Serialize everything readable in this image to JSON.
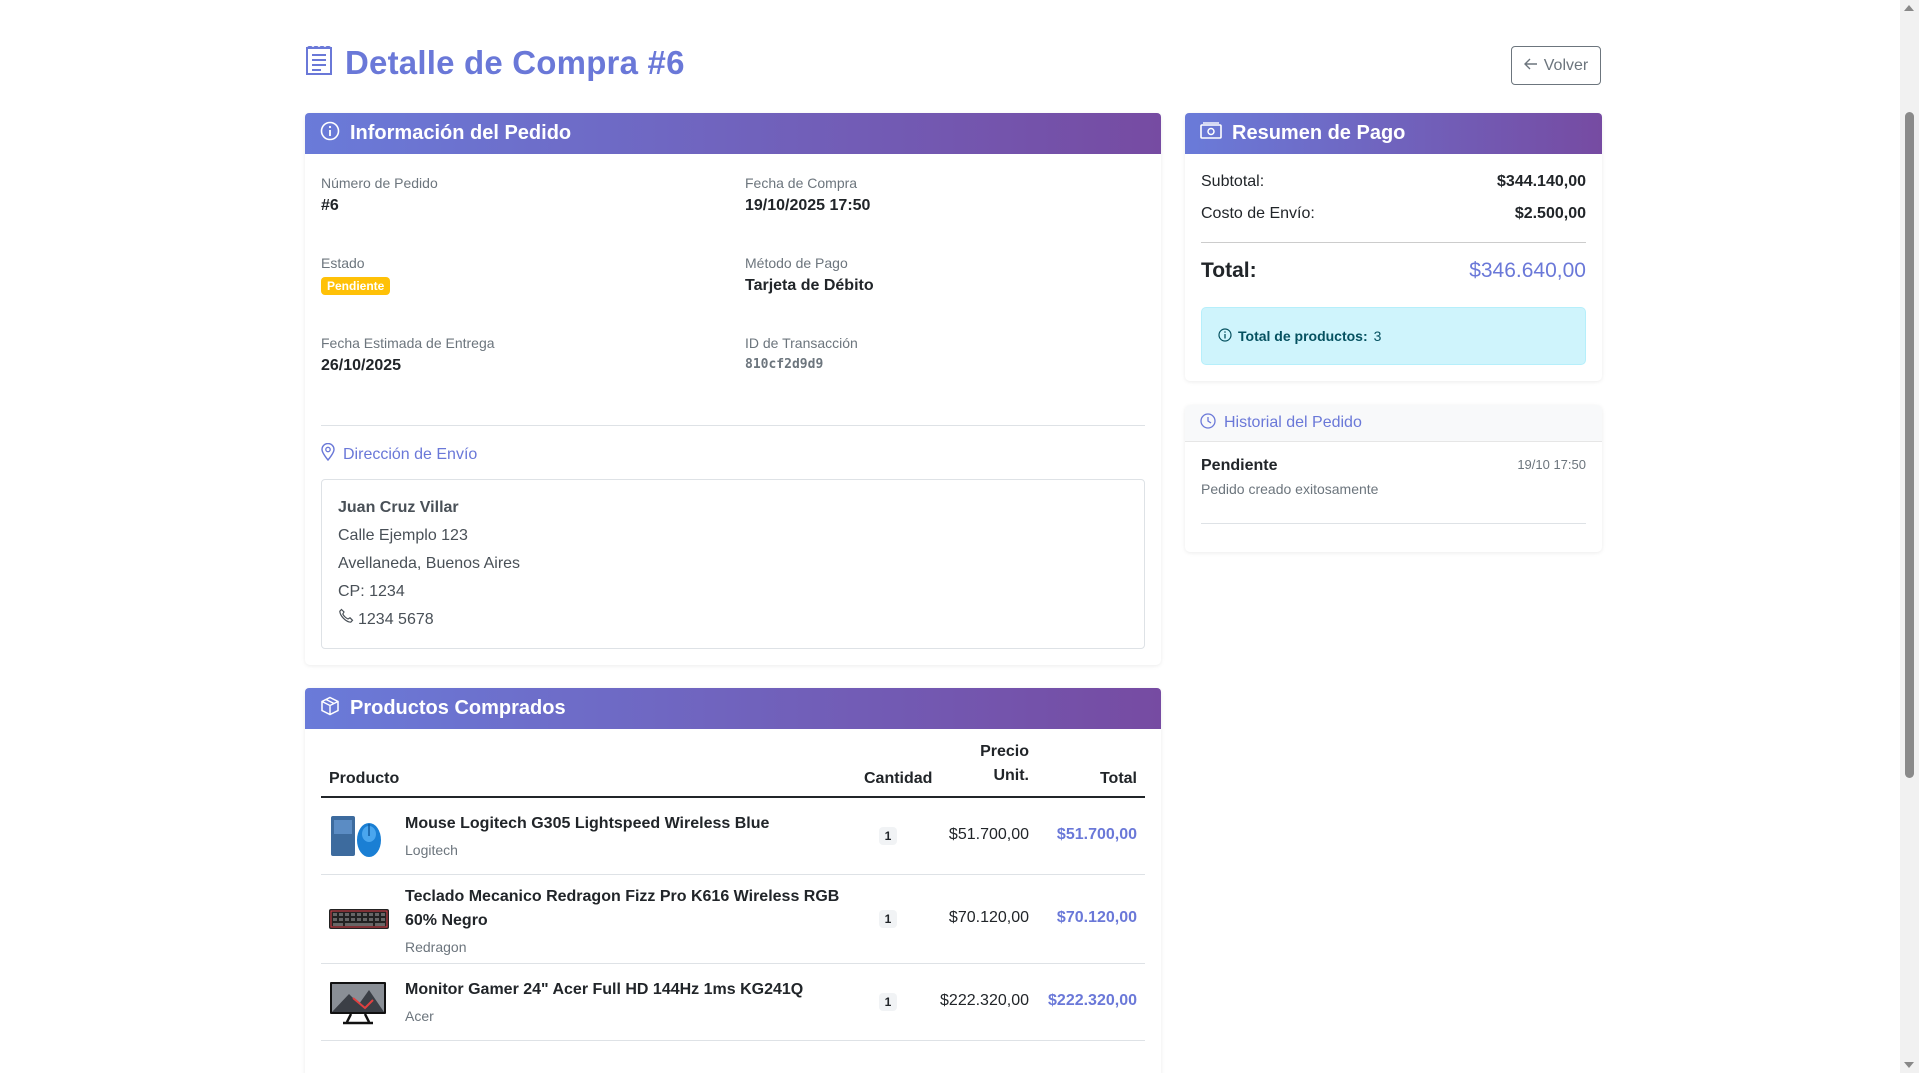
{
  "header": {
    "title": "Detalle de Compra #6",
    "back_label": "Volver"
  },
  "info": {
    "title": "Información del Pedido",
    "order_number_label": "Número de Pedido",
    "order_number": "#6",
    "purchase_date_label": "Fecha de Compra",
    "purchase_date": "19/10/2025 17:50",
    "status_label": "Estado",
    "status": "Pendiente",
    "payment_method_label": "Método de Pago",
    "payment_method": "Tarjeta de Débito",
    "delivery_label": "Fecha Estimada de Entrega",
    "delivery_date": "26/10/2025",
    "transaction_label": "ID de Transacción",
    "transaction_id": "810cf2d9d9",
    "address_title": "Dirección de Envío",
    "address": {
      "name": "Juan Cruz Villar",
      "street": "Calle Ejemplo 123",
      "city": "Avellaneda, Buenos Aires",
      "zip": "CP: 1234",
      "phone": "1234 5678"
    }
  },
  "payment": {
    "title": "Resumen de Pago",
    "subtotal_label": "Subtotal:",
    "subtotal": "$344.140,00",
    "shipping_label": "Costo de Envío:",
    "shipping": "$2.500,00",
    "total_label": "Total:",
    "total": "$346.640,00",
    "products_count_label": "Total de productos:",
    "products_count": "3"
  },
  "history": {
    "title": "Historial del Pedido",
    "status": "Pendiente",
    "date": "19/10 17:50",
    "description": "Pedido creado exitosamente"
  },
  "products": {
    "title": "Productos Comprados",
    "headers": {
      "product": "Producto",
      "qty": "Cantidad",
      "unit_line1": "Precio",
      "unit_line2": "Unit.",
      "total": "Total"
    },
    "items": [
      {
        "name": "Mouse Logitech G305 Lightspeed Wireless Blue",
        "brand": "Logitech",
        "qty": "1",
        "unit": "$51.700,00",
        "total": "$51.700,00"
      },
      {
        "name_line1": "Teclado Mecanico Redragon Fizz Pro K616 Wireless RGB",
        "name_line2": "60% Negro",
        "brand": "Redragon",
        "qty": "1",
        "unit": "$70.120,00",
        "total": "$70.120,00"
      },
      {
        "name": "Monitor Gamer 24\" Acer Full HD 144Hz 1ms KG241Q",
        "brand": "Acer",
        "qty": "1",
        "unit": "$222.320,00",
        "total": "$222.320,00"
      }
    ]
  },
  "colors": {
    "accent": "#6a78d8",
    "gradient_start": "#6a7bd9",
    "gradient_end": "#764ba2",
    "warning": "#ffc107",
    "info_bg": "#cff4fc"
  },
  "icons": {
    "title": "receipt-icon",
    "back": "arrow-left-icon",
    "info": "info-circle-icon",
    "payment": "cash-icon",
    "address": "geo-pin-icon",
    "phone": "phone-icon",
    "history": "clock-icon",
    "products": "box-icon"
  }
}
